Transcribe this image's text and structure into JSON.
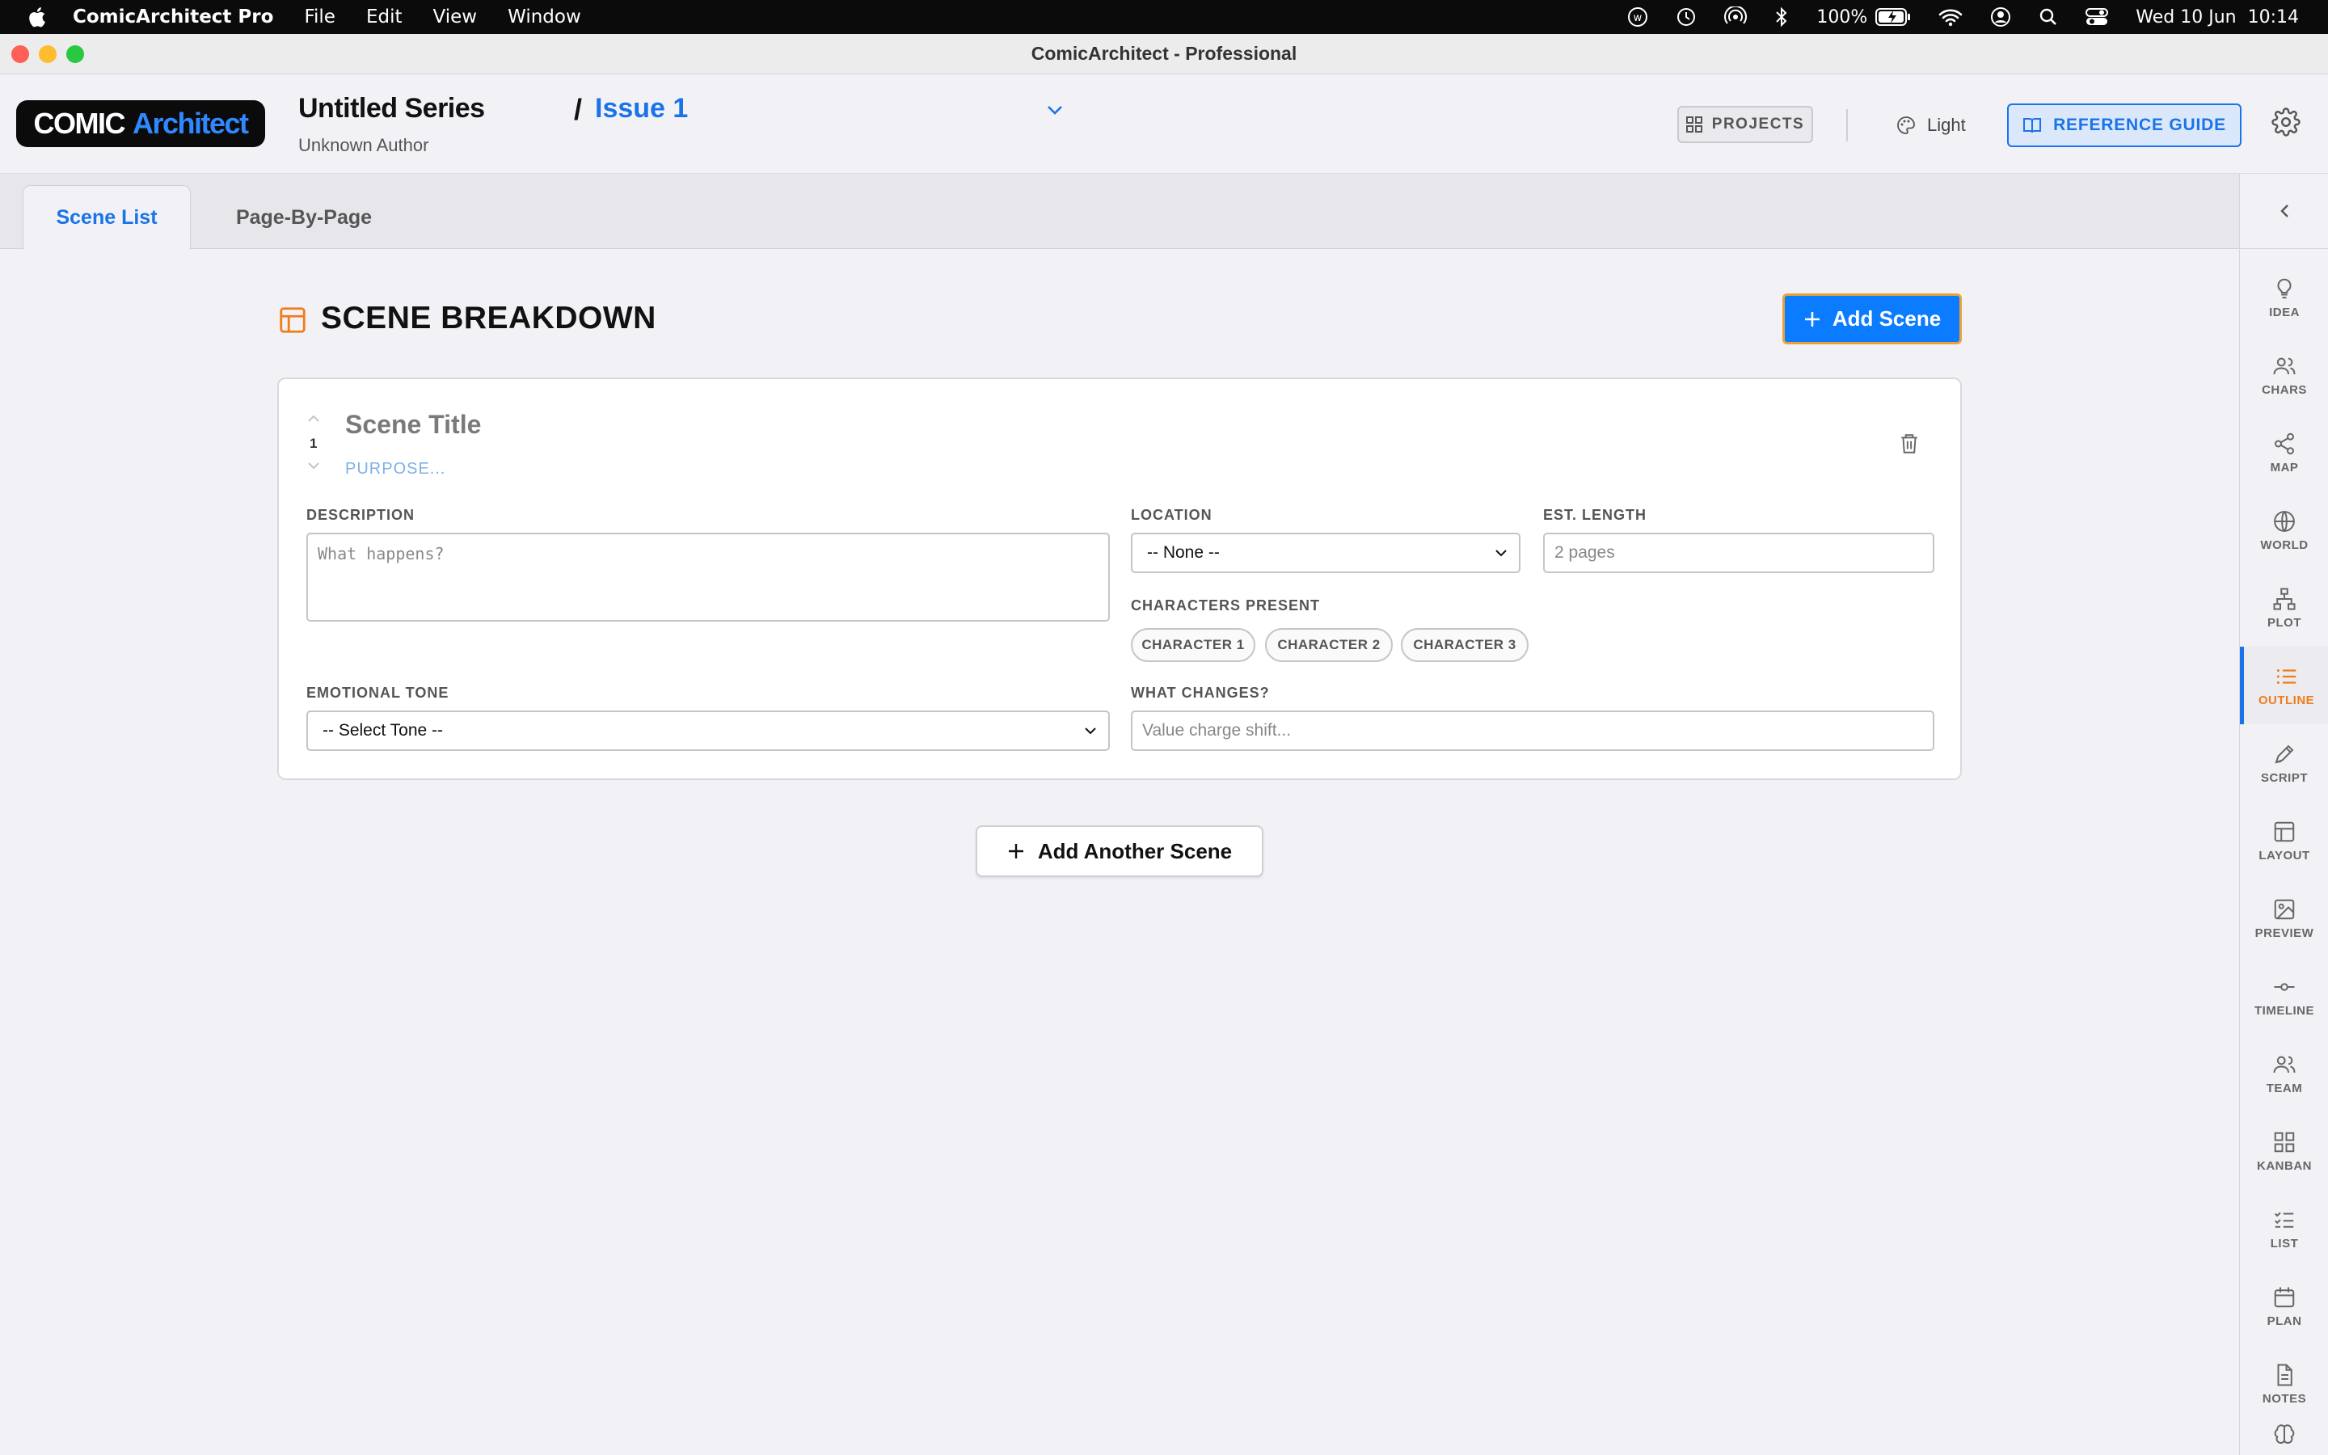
{
  "menubar": {
    "app_name": "ComicArchitect Pro",
    "menus": [
      "File",
      "Edit",
      "View",
      "Window"
    ],
    "battery": "100%",
    "datetime": "Wed 10 Jun  10:14"
  },
  "window": {
    "title": "ComicArchitect - Professional"
  },
  "header": {
    "logo_part1": "COMIC",
    "logo_part2": "Architect",
    "series_title": "Untitled Series",
    "author": "Unknown Author",
    "separator": "/",
    "issue_title": "Issue 1",
    "projects_label": "PROJECTS",
    "theme_label": "Light",
    "reference_label": "REFERENCE GUIDE"
  },
  "tabs": {
    "scene_list": "Scene List",
    "page_by_page": "Page-By-Page"
  },
  "main": {
    "section_title": "SCENE BREAKDOWN",
    "add_scene_label": "Add Scene",
    "add_another_label": "Add Another Scene"
  },
  "scene": {
    "number": "1",
    "title_placeholder": "Scene Title",
    "purpose_placeholder": "PURPOSE...",
    "description_label": "DESCRIPTION",
    "description_placeholder": "What happens?",
    "location_label": "LOCATION",
    "location_value": "-- None --",
    "length_label": "EST. LENGTH",
    "length_placeholder": "2 pages",
    "characters_label": "CHARACTERS PRESENT",
    "characters": [
      "CHARACTER 1",
      "CHARACTER 2",
      "CHARACTER 3"
    ],
    "tone_label": "EMOTIONAL TONE",
    "tone_value": "-- Select Tone --",
    "changes_label": "WHAT CHANGES?",
    "changes_placeholder": "Value charge shift..."
  },
  "sidebar": {
    "items": [
      {
        "label": "IDEA",
        "icon": "lightbulb-icon"
      },
      {
        "label": "CHARS",
        "icon": "users-icon"
      },
      {
        "label": "MAP",
        "icon": "share-nodes-icon"
      },
      {
        "label": "WORLD",
        "icon": "globe-icon"
      },
      {
        "label": "PLOT",
        "icon": "flowchart-icon"
      },
      {
        "label": "OUTLINE",
        "icon": "list-icon",
        "active": true
      },
      {
        "label": "SCRIPT",
        "icon": "pen-icon"
      },
      {
        "label": "LAYOUT",
        "icon": "layout-icon"
      },
      {
        "label": "PREVIEW",
        "icon": "image-icon"
      },
      {
        "label": "TIMELINE",
        "icon": "timeline-icon"
      },
      {
        "label": "TEAM",
        "icon": "team-icon"
      },
      {
        "label": "KANBAN",
        "icon": "grid-icon"
      },
      {
        "label": "LIST",
        "icon": "checklist-icon"
      },
      {
        "label": "PLAN",
        "icon": "calendar-icon"
      },
      {
        "label": "NOTES",
        "icon": "document-icon"
      }
    ]
  },
  "colors": {
    "accent": "#1a73e8",
    "orange": "#f07c1b",
    "add_button": "#0b7cff"
  }
}
